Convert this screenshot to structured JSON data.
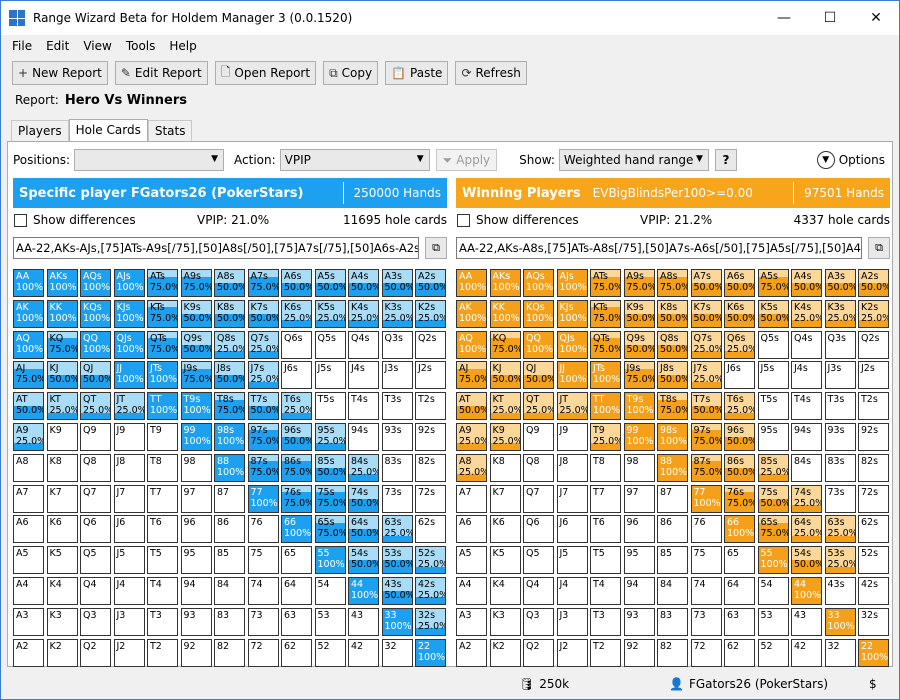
{
  "window": {
    "title": "Range Wizard Beta for Holdem Manager 3 (0.0.1520)",
    "minimize": "—",
    "maximize": "☐",
    "close": "✕"
  },
  "menu": [
    "File",
    "Edit",
    "View",
    "Tools",
    "Help"
  ],
  "toolbar": [
    {
      "icon": "plus-icon",
      "glyph": "+",
      "label": "New Report"
    },
    {
      "icon": "edit-icon",
      "glyph": "✎",
      "label": "Edit Report"
    },
    {
      "icon": "document-icon",
      "glyph": "🗋",
      "label": "Open Report"
    },
    {
      "icon": "copy-icon",
      "glyph": "⧉",
      "label": "Copy"
    },
    {
      "icon": "paste-icon",
      "glyph": "📋",
      "label": "Paste"
    },
    {
      "icon": "refresh-icon",
      "glyph": "⟳",
      "label": "Refresh"
    }
  ],
  "report": {
    "label": "Report:",
    "name": "Hero Vs Winners"
  },
  "tabs": [
    {
      "label": "Players"
    },
    {
      "label": "Hole Cards",
      "active": true
    },
    {
      "label": "Stats"
    }
  ],
  "filters": {
    "positions_label": "Positions:",
    "positions_value": "",
    "action_label": "Action:",
    "action_value": "VPIP",
    "apply_label": "Apply",
    "show_label": "Show:",
    "show_value": "Weighted hand range",
    "help_label": "?",
    "options_label": "Options"
  },
  "colors": {
    "blue_header": "#1ea0f0",
    "orange_header": "#f7a51a",
    "blue_dark": "#1ea0f0",
    "blue_light": "#a8dcf7",
    "orange_dark": "#f5a01a",
    "orange_light": "#fbd89a"
  },
  "left": {
    "title": "Specific player FGators26 (PokerStars)",
    "subtitle": "",
    "hands": "250000 Hands",
    "show_diff": "Show differences",
    "vpip": "VPIP: 21.0%",
    "hole_cards": "11695 hole cards",
    "range": "AA-22,AKs-AJs,[75]ATs-A9s[/75],[50]A8s[/50],[75]A7s[/75],[50]A6s-A2s[/50],K",
    "cells": [
      [
        "AA",
        "100%"
      ],
      [
        "AKs",
        "100%"
      ],
      [
        "AQs",
        "100%"
      ],
      [
        "AJs",
        "100%"
      ],
      [
        "ATs",
        "75.0%"
      ],
      [
        "A9s",
        "75.0%"
      ],
      [
        "A8s",
        "50.0%"
      ],
      [
        "A7s",
        "75.0%"
      ],
      [
        "A6s",
        "50.0%"
      ],
      [
        "A5s",
        "50.0%"
      ],
      [
        "A4s",
        "50.0%"
      ],
      [
        "A3s",
        "50.0%"
      ],
      [
        "A2s",
        "50.0%"
      ],
      [
        "AK",
        "100%"
      ],
      [
        "KK",
        "100%"
      ],
      [
        "KQs",
        "100%"
      ],
      [
        "KJs",
        "100%"
      ],
      [
        "KTs",
        "75.0%"
      ],
      [
        "K9s",
        "50.0%"
      ],
      [
        "K8s",
        "50.0%"
      ],
      [
        "K7s",
        "50.0%"
      ],
      [
        "K6s",
        "25.0%"
      ],
      [
        "K5s",
        "25.0%"
      ],
      [
        "K4s",
        "25.0%"
      ],
      [
        "K3s",
        "25.0%"
      ],
      [
        "K2s",
        "25.0%"
      ],
      [
        "AQ",
        "100%"
      ],
      [
        "KQ",
        "75.0%"
      ],
      [
        "QQ",
        "100%"
      ],
      [
        "QJs",
        "100%"
      ],
      [
        "QTs",
        "75.0%"
      ],
      [
        "Q9s",
        "50.0%"
      ],
      [
        "Q8s",
        "25.0%"
      ],
      [
        "Q7s",
        "25.0%"
      ],
      [
        "Q6s",
        ""
      ],
      [
        "Q5s",
        ""
      ],
      [
        "Q4s",
        ""
      ],
      [
        "Q3s",
        ""
      ],
      [
        "Q2s",
        ""
      ],
      [
        "AJ",
        "75.0%"
      ],
      [
        "KJ",
        "50.0%"
      ],
      [
        "QJ",
        "50.0%"
      ],
      [
        "JJ",
        "100%"
      ],
      [
        "JTs",
        "100%"
      ],
      [
        "J9s",
        "75.0%"
      ],
      [
        "J8s",
        "50.0%"
      ],
      [
        "J7s",
        "25.0%"
      ],
      [
        "J6s",
        ""
      ],
      [
        "J5s",
        ""
      ],
      [
        "J4s",
        ""
      ],
      [
        "J3s",
        ""
      ],
      [
        "J2s",
        ""
      ],
      [
        "AT",
        "50.0%"
      ],
      [
        "KT",
        "25.0%"
      ],
      [
        "QT",
        "25.0%"
      ],
      [
        "JT",
        "25.0%"
      ],
      [
        "TT",
        "100%"
      ],
      [
        "T9s",
        "100%"
      ],
      [
        "T8s",
        "75.0%"
      ],
      [
        "T7s",
        "50.0%"
      ],
      [
        "T6s",
        "25.0%"
      ],
      [
        "T5s",
        ""
      ],
      [
        "T4s",
        ""
      ],
      [
        "T3s",
        ""
      ],
      [
        "T2s",
        ""
      ],
      [
        "A9",
        "25.0%"
      ],
      [
        "K9",
        ""
      ],
      [
        "Q9",
        ""
      ],
      [
        "J9",
        ""
      ],
      [
        "T9",
        ""
      ],
      [
        "99",
        "100%"
      ],
      [
        "98s",
        "100%"
      ],
      [
        "97s",
        "75.0%"
      ],
      [
        "96s",
        "50.0%"
      ],
      [
        "95s",
        "25.0%"
      ],
      [
        "94s",
        ""
      ],
      [
        "93s",
        ""
      ],
      [
        "92s",
        ""
      ],
      [
        "A8",
        ""
      ],
      [
        "K8",
        ""
      ],
      [
        "Q8",
        ""
      ],
      [
        "J8",
        ""
      ],
      [
        "T8",
        ""
      ],
      [
        "98",
        ""
      ],
      [
        "88",
        "100%"
      ],
      [
        "87s",
        "75.0%"
      ],
      [
        "86s",
        "75.0%"
      ],
      [
        "85s",
        "50.0%"
      ],
      [
        "84s",
        "25.0%"
      ],
      [
        "83s",
        ""
      ],
      [
        "82s",
        ""
      ],
      [
        "A7",
        ""
      ],
      [
        "K7",
        ""
      ],
      [
        "Q7",
        ""
      ],
      [
        "J7",
        ""
      ],
      [
        "T7",
        ""
      ],
      [
        "97",
        ""
      ],
      [
        "87",
        ""
      ],
      [
        "77",
        "100%"
      ],
      [
        "76s",
        "75.0%"
      ],
      [
        "75s",
        "75.0%"
      ],
      [
        "74s",
        "50.0%"
      ],
      [
        "73s",
        ""
      ],
      [
        "72s",
        ""
      ],
      [
        "A6",
        ""
      ],
      [
        "K6",
        ""
      ],
      [
        "Q6",
        ""
      ],
      [
        "J6",
        ""
      ],
      [
        "T6",
        ""
      ],
      [
        "96",
        ""
      ],
      [
        "86",
        ""
      ],
      [
        "76",
        ""
      ],
      [
        "66",
        "100%"
      ],
      [
        "65s",
        "75.0%"
      ],
      [
        "64s",
        "50.0%"
      ],
      [
        "63s",
        "25.0%"
      ],
      [
        "62s",
        ""
      ],
      [
        "A5",
        ""
      ],
      [
        "K5",
        ""
      ],
      [
        "Q5",
        ""
      ],
      [
        "J5",
        ""
      ],
      [
        "T5",
        ""
      ],
      [
        "95",
        ""
      ],
      [
        "85",
        ""
      ],
      [
        "75",
        ""
      ],
      [
        "65",
        ""
      ],
      [
        "55",
        "100%"
      ],
      [
        "54s",
        "50.0%"
      ],
      [
        "53s",
        "50.0%"
      ],
      [
        "52s",
        "25.0%"
      ],
      [
        "A4",
        ""
      ],
      [
        "K4",
        ""
      ],
      [
        "Q4",
        ""
      ],
      [
        "J4",
        ""
      ],
      [
        "T4",
        ""
      ],
      [
        "94",
        ""
      ],
      [
        "84",
        ""
      ],
      [
        "74",
        ""
      ],
      [
        "64",
        ""
      ],
      [
        "54",
        ""
      ],
      [
        "44",
        "100%"
      ],
      [
        "43s",
        "50.0%"
      ],
      [
        "42s",
        "25.0%"
      ],
      [
        "A3",
        ""
      ],
      [
        "K3",
        ""
      ],
      [
        "Q3",
        ""
      ],
      [
        "J3",
        ""
      ],
      [
        "T3",
        ""
      ],
      [
        "93",
        ""
      ],
      [
        "83",
        ""
      ],
      [
        "73",
        ""
      ],
      [
        "63",
        ""
      ],
      [
        "53",
        ""
      ],
      [
        "43",
        ""
      ],
      [
        "33",
        "100%"
      ],
      [
        "32s",
        "25.0%"
      ],
      [
        "A2",
        ""
      ],
      [
        "K2",
        ""
      ],
      [
        "Q2",
        ""
      ],
      [
        "J2",
        ""
      ],
      [
        "T2",
        ""
      ],
      [
        "92",
        ""
      ],
      [
        "82",
        ""
      ],
      [
        "72",
        ""
      ],
      [
        "62",
        ""
      ],
      [
        "52",
        ""
      ],
      [
        "42",
        ""
      ],
      [
        "32",
        ""
      ],
      [
        "22",
        "100%"
      ]
    ]
  },
  "right": {
    "title": "Winning Players",
    "subtitle": "EVBigBlindsPer100>=0.00",
    "hands": "97501 Hands",
    "show_diff": "Show differences",
    "vpip": "VPIP: 21.2%",
    "hole_cards": "4337 hole cards",
    "range": "AA-22,AKs-A8s,[75]ATs-A8s[/75],[50]A7s-A6s[/50],[75]A5s[/75],[50]A4s-A2s[/5",
    "cells": [
      [
        "AA",
        "100%"
      ],
      [
        "AKs",
        "100%"
      ],
      [
        "AQs",
        "100%"
      ],
      [
        "AJs",
        "100%"
      ],
      [
        "ATs",
        "75.0%"
      ],
      [
        "A9s",
        "75.0%"
      ],
      [
        "A8s",
        "75.0%"
      ],
      [
        "A7s",
        "50.0%"
      ],
      [
        "A6s",
        "50.0%"
      ],
      [
        "A5s",
        "75.0%"
      ],
      [
        "A4s",
        "50.0%"
      ],
      [
        "A3s",
        "50.0%"
      ],
      [
        "A2s",
        "50.0%"
      ],
      [
        "AK",
        "100%"
      ],
      [
        "KK",
        "100%"
      ],
      [
        "KQs",
        "100%"
      ],
      [
        "KJs",
        "100%"
      ],
      [
        "KTs",
        "75.0%"
      ],
      [
        "K9s",
        "50.0%"
      ],
      [
        "K8s",
        "50.0%"
      ],
      [
        "K7s",
        "50.0%"
      ],
      [
        "K6s",
        "50.0%"
      ],
      [
        "K5s",
        "50.0%"
      ],
      [
        "K4s",
        "25.0%"
      ],
      [
        "K3s",
        "25.0%"
      ],
      [
        "K2s",
        "25.0%"
      ],
      [
        "AQ",
        "100%"
      ],
      [
        "KQ",
        "75.0%"
      ],
      [
        "QQ",
        "100%"
      ],
      [
        "QJs",
        "100%"
      ],
      [
        "QTs",
        "75.0%"
      ],
      [
        "Q9s",
        "50.0%"
      ],
      [
        "Q8s",
        "50.0%"
      ],
      [
        "Q7s",
        "25.0%"
      ],
      [
        "Q6s",
        "25.0%"
      ],
      [
        "Q5s",
        ""
      ],
      [
        "Q4s",
        ""
      ],
      [
        "Q3s",
        ""
      ],
      [
        "Q2s",
        ""
      ],
      [
        "AJ",
        "75.0%"
      ],
      [
        "KJ",
        "50.0%"
      ],
      [
        "QJ",
        "50.0%"
      ],
      [
        "JJ",
        "100%"
      ],
      [
        "JTs",
        "100%"
      ],
      [
        "J9s",
        "75.0%"
      ],
      [
        "J8s",
        "50.0%"
      ],
      [
        "J7s",
        "25.0%"
      ],
      [
        "J6s",
        ""
      ],
      [
        "J5s",
        ""
      ],
      [
        "J4s",
        ""
      ],
      [
        "J3s",
        ""
      ],
      [
        "J2s",
        ""
      ],
      [
        "AT",
        "50.0%"
      ],
      [
        "KT",
        "25.0%"
      ],
      [
        "QT",
        "25.0%"
      ],
      [
        "JT",
        "25.0%"
      ],
      [
        "TT",
        "100%"
      ],
      [
        "T9s",
        "100%"
      ],
      [
        "T8s",
        "75.0%"
      ],
      [
        "T7s",
        "50.0%"
      ],
      [
        "T6s",
        "25.0%"
      ],
      [
        "T5s",
        ""
      ],
      [
        "T4s",
        ""
      ],
      [
        "T3s",
        ""
      ],
      [
        "T2s",
        ""
      ],
      [
        "A9",
        "25.0%"
      ],
      [
        "K9",
        "25.0%"
      ],
      [
        "Q9",
        ""
      ],
      [
        "J9",
        ""
      ],
      [
        "T9",
        "25.0%"
      ],
      [
        "99",
        "100%"
      ],
      [
        "98s",
        "100%"
      ],
      [
        "97s",
        "75.0%"
      ],
      [
        "96s",
        "50.0%"
      ],
      [
        "95s",
        ""
      ],
      [
        "94s",
        ""
      ],
      [
        "93s",
        ""
      ],
      [
        "92s",
        ""
      ],
      [
        "A8",
        "25.0%"
      ],
      [
        "K8",
        ""
      ],
      [
        "Q8",
        ""
      ],
      [
        "J8",
        ""
      ],
      [
        "T8",
        ""
      ],
      [
        "98",
        ""
      ],
      [
        "88",
        "100%"
      ],
      [
        "87s",
        "75.0%"
      ],
      [
        "86s",
        "50.0%"
      ],
      [
        "85s",
        "25.0%"
      ],
      [
        "84s",
        ""
      ],
      [
        "83s",
        ""
      ],
      [
        "82s",
        ""
      ],
      [
        "A7",
        ""
      ],
      [
        "K7",
        ""
      ],
      [
        "Q7",
        ""
      ],
      [
        "J7",
        ""
      ],
      [
        "T7",
        ""
      ],
      [
        "97",
        ""
      ],
      [
        "87",
        ""
      ],
      [
        "77",
        "100%"
      ],
      [
        "76s",
        "75.0%"
      ],
      [
        "75s",
        "50.0%"
      ],
      [
        "74s",
        "25.0%"
      ],
      [
        "73s",
        ""
      ],
      [
        "72s",
        ""
      ],
      [
        "A6",
        ""
      ],
      [
        "K6",
        ""
      ],
      [
        "Q6",
        ""
      ],
      [
        "J6",
        ""
      ],
      [
        "T6",
        ""
      ],
      [
        "96",
        ""
      ],
      [
        "86",
        ""
      ],
      [
        "76",
        ""
      ],
      [
        "66",
        "100%"
      ],
      [
        "65s",
        "75.0%"
      ],
      [
        "64s",
        "25.0%"
      ],
      [
        "63s",
        "25.0%"
      ],
      [
        "62s",
        ""
      ],
      [
        "A5",
        ""
      ],
      [
        "K5",
        ""
      ],
      [
        "Q5",
        ""
      ],
      [
        "J5",
        ""
      ],
      [
        "T5",
        ""
      ],
      [
        "95",
        ""
      ],
      [
        "85",
        ""
      ],
      [
        "75",
        ""
      ],
      [
        "65",
        ""
      ],
      [
        "55",
        "100%"
      ],
      [
        "54s",
        "50.0%"
      ],
      [
        "53s",
        "25.0%"
      ],
      [
        "52s",
        ""
      ],
      [
        "A4",
        ""
      ],
      [
        "K4",
        ""
      ],
      [
        "Q4",
        ""
      ],
      [
        "J4",
        ""
      ],
      [
        "T4",
        ""
      ],
      [
        "94",
        ""
      ],
      [
        "84",
        ""
      ],
      [
        "74",
        ""
      ],
      [
        "64",
        ""
      ],
      [
        "54",
        ""
      ],
      [
        "44",
        "100%"
      ],
      [
        "43s",
        ""
      ],
      [
        "42s",
        ""
      ],
      [
        "A3",
        ""
      ],
      [
        "K3",
        ""
      ],
      [
        "Q3",
        ""
      ],
      [
        "J3",
        ""
      ],
      [
        "T3",
        ""
      ],
      [
        "93",
        ""
      ],
      [
        "83",
        ""
      ],
      [
        "73",
        ""
      ],
      [
        "63",
        ""
      ],
      [
        "53",
        ""
      ],
      [
        "43",
        ""
      ],
      [
        "33",
        "100%"
      ],
      [
        "32s",
        ""
      ],
      [
        "A2",
        ""
      ],
      [
        "K2",
        ""
      ],
      [
        "Q2",
        ""
      ],
      [
        "J2",
        ""
      ],
      [
        "T2",
        ""
      ],
      [
        "92",
        ""
      ],
      [
        "82",
        ""
      ],
      [
        "72",
        ""
      ],
      [
        "62",
        ""
      ],
      [
        "52",
        ""
      ],
      [
        "42",
        ""
      ],
      [
        "32",
        ""
      ],
      [
        "22",
        "100%"
      ]
    ]
  },
  "status": {
    "db": "250k",
    "player": "FGators26 (PokerStars)",
    "dollar": "$"
  }
}
